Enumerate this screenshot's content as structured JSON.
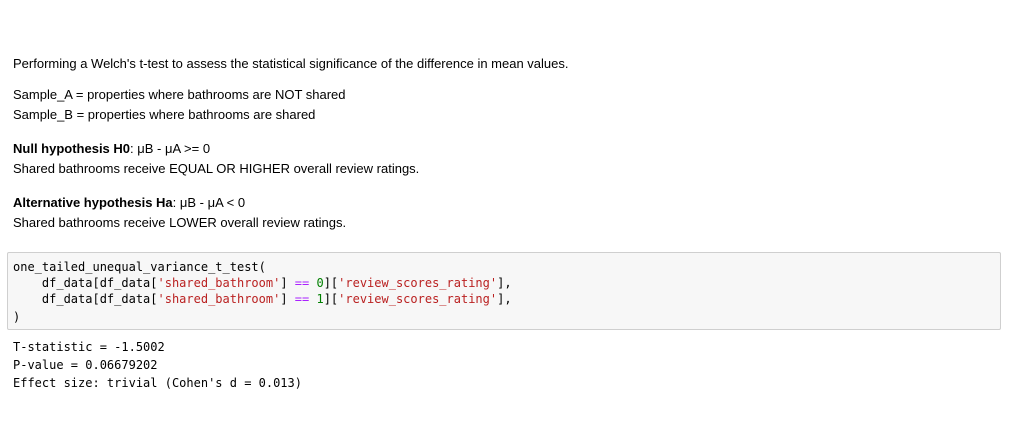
{
  "markdown": {
    "intro": "Performing a Welch's t-test to assess the statistical significance of the difference in mean values.",
    "sample_a": "Sample_A = properties where bathrooms are NOT shared",
    "sample_b": "Sample_B = properties where bathrooms are shared",
    "null_label": "Null hypothesis H0",
    "null_formula": ": μB - μA >= 0",
    "null_desc": "Shared bathrooms receive EQUAL OR HIGHER overall review ratings.",
    "alt_label": "Alternative hypothesis Ha",
    "alt_formula": ": μB - μA < 0",
    "alt_desc": "Shared bathrooms receive LOWER overall review ratings."
  },
  "code": {
    "line1": "one_tailed_unequal_variance_t_test(",
    "indent": "    ",
    "df1": "df_data[df_data[",
    "col_str": "'shared_bathroom'",
    "bracket_close": "] ",
    "eq_op": "==",
    "space": " ",
    "val0": "0",
    "val1": "1",
    "mid": "][",
    "rating_str": "'review_scores_rating'",
    "end": "],",
    "line4": ")"
  },
  "output": {
    "t_stat": "T-statistic = -1.5002",
    "p_value": "P-value = 0.06679202",
    "effect": "Effect size: trivial (Cohen's d = 0.013)"
  }
}
